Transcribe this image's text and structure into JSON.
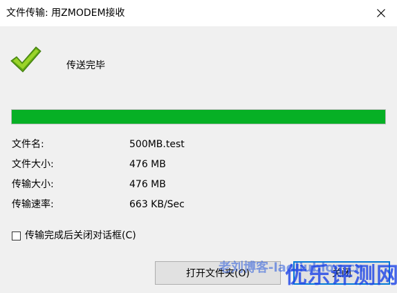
{
  "window": {
    "title": "文件传输: 用ZMODEM接收"
  },
  "status": {
    "message": "传送完毕",
    "progress_percent": 100,
    "progress_color": "#06b025"
  },
  "info": {
    "rows": [
      {
        "label": "文件名:",
        "value": "500MB.test"
      },
      {
        "label": "文件大小:",
        "value": "476 MB"
      },
      {
        "label": "传输大小:",
        "value": "476 MB"
      },
      {
        "label": "传输速率:",
        "value": "663 KB/Sec"
      }
    ]
  },
  "options": {
    "close_after_done_label": "传输完成后关闭对话框(C)",
    "close_after_done_checked": false
  },
  "buttons": {
    "open_folder": "打开文件夹(O)",
    "close": "关闭"
  },
  "watermark": {
    "small": "老刘博客-laoliublog.cn",
    "large": "优乐评测网"
  },
  "icons": {
    "status": "checkmark-icon",
    "close": "close-icon"
  }
}
